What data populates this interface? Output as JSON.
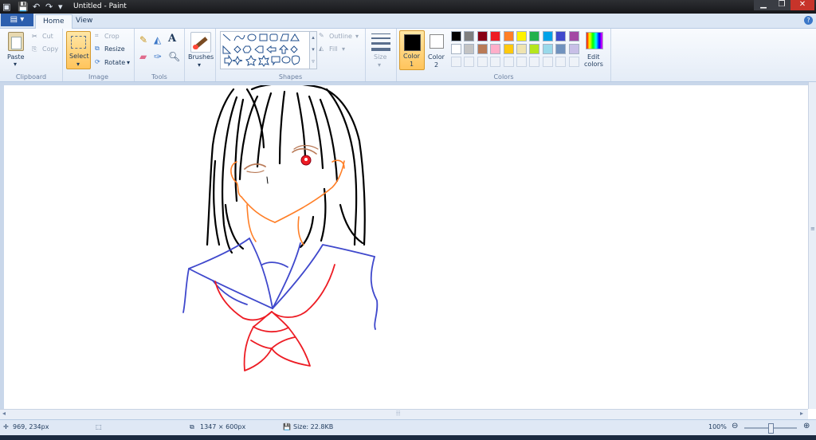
{
  "window": {
    "title": "Untitled - Paint"
  },
  "tabs": {
    "file_icon": "file-menu-icon",
    "home": "Home",
    "view": "View"
  },
  "clipboard": {
    "paste": "Paste",
    "cut": "Cut",
    "copy": "Copy",
    "group": "Clipboard"
  },
  "image": {
    "select": "Select",
    "crop": "Crop",
    "resize": "Resize",
    "rotate": "Rotate",
    "group": "Image"
  },
  "tools": {
    "group": "Tools",
    "text_tool": "A"
  },
  "brushes": {
    "label": "Brushes"
  },
  "shapes": {
    "outline": "Outline",
    "fill": "Fill",
    "group": "Shapes"
  },
  "size": {
    "label": "Size"
  },
  "colors": {
    "color1_label": "Color",
    "color1_num": "1",
    "color2_label": "Color",
    "color2_num": "2",
    "color1": "#000000",
    "color2": "#ffffff",
    "edit_label": "Edit",
    "edit_label2": "colors",
    "group": "Colors",
    "palette_row1": [
      "#000000",
      "#7f7f7f",
      "#880015",
      "#ed1c24",
      "#ff7f27",
      "#fff200",
      "#22b14c",
      "#00a2e8",
      "#3f48cc",
      "#a349a4"
    ],
    "palette_row2": [
      "#ffffff",
      "#c3c3c3",
      "#b97a57",
      "#ffaec9",
      "#ffc90e",
      "#efe4b0",
      "#b5e61d",
      "#99d9ea",
      "#7092be",
      "#c8bfe7"
    ]
  },
  "status": {
    "cursor": "969, 234px",
    "dimensions": "1347 × 600px",
    "size": "Size: 22.8KB",
    "zoom": "100%"
  }
}
